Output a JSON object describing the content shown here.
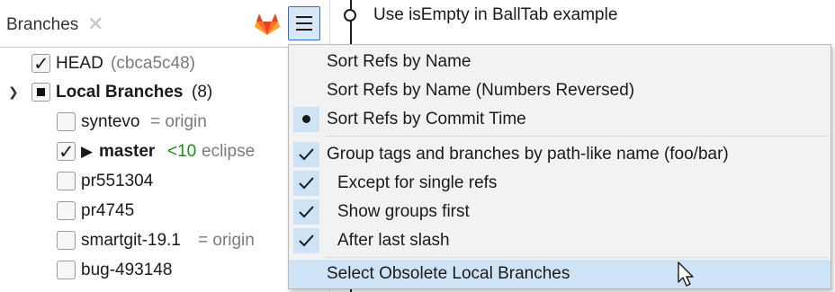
{
  "panel": {
    "title": "Branches",
    "close_glyph": "✕"
  },
  "tree": {
    "head": {
      "label": "HEAD",
      "hash": "(cbca5c48)"
    },
    "local": {
      "label": "Local Branches",
      "count": "(8)"
    },
    "branches": [
      {
        "name": "syntevo",
        "tracking": "= origin"
      },
      {
        "name": "master",
        "ahead": "<10",
        "tracking": "eclipse"
      },
      {
        "name": "pr551304"
      },
      {
        "name": "pr4745"
      },
      {
        "name": "smartgit-19.1",
        "tracking": "= origin"
      },
      {
        "name": "bug-493148"
      }
    ]
  },
  "history": {
    "commit_message": "Use isEmpty in BallTab example"
  },
  "menu": {
    "items": [
      {
        "label": "Sort Refs by Name"
      },
      {
        "label": "Sort Refs by Name (Numbers Reversed)"
      },
      {
        "label": "Sort Refs by Commit Time",
        "state": "radio-selected"
      },
      {
        "label": "Group tags and branches by path-like name (foo/bar)",
        "state": "checked"
      },
      {
        "label": "Except for single refs",
        "state": "checked"
      },
      {
        "label": "Show groups first",
        "state": "checked"
      },
      {
        "label": "After last slash",
        "state": "checked"
      },
      {
        "label": "Select Obsolete Local Branches",
        "state": "highlighted"
      }
    ]
  },
  "icons": {
    "close": "close-icon",
    "gitlab": "gitlab-logo-icon",
    "menu": "hamburger-menu-icon",
    "cursor": "mouse-pointer-icon"
  },
  "colors": {
    "accent": "#2a6fc9",
    "selection": "#cfe3f7",
    "green": "#1f8a1f",
    "gitlab_orange": "#e24329"
  }
}
